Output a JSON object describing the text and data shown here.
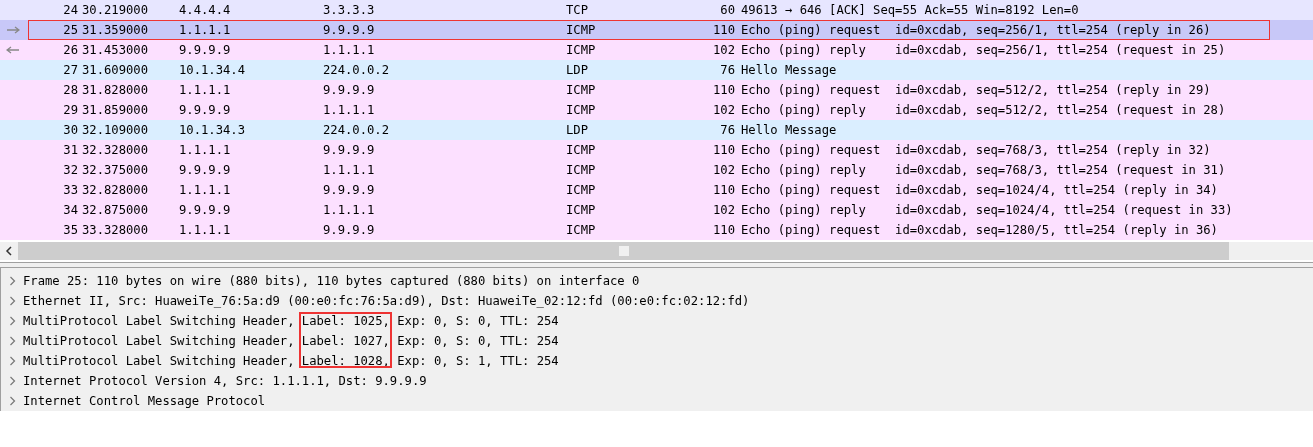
{
  "packets": [
    {
      "no": "24",
      "time": "30.219000",
      "source": "4.4.4.4",
      "destination": "3.3.3.3",
      "protocol": "TCP",
      "length": "60",
      "info": "49613 → 646 [ACK] Seq=55 Ack=55 Win=8192 Len=0",
      "selected": false,
      "kind": "plain",
      "annotated": false
    },
    {
      "no": "25",
      "time": "31.359000",
      "source": "1.1.1.1",
      "destination": "9.9.9.9",
      "protocol": "ICMP",
      "length": "110",
      "info": "Echo (ping) request  id=0xcdab, seq=256/1, ttl=254 (reply in 26)",
      "selected": true,
      "kind": "request",
      "annotated": true
    },
    {
      "no": "26",
      "time": "31.453000",
      "source": "9.9.9.9",
      "destination": "1.1.1.1",
      "protocol": "ICMP",
      "length": "102",
      "info": "Echo (ping) reply    id=0xcdab, seq=256/1, ttl=254 (request in 25)",
      "selected": false,
      "kind": "reply",
      "annotated": false
    },
    {
      "no": "27",
      "time": "31.609000",
      "source": "10.1.34.4",
      "destination": "224.0.0.2",
      "protocol": "LDP",
      "length": "76",
      "info": "Hello Message",
      "selected": false,
      "kind": "plain",
      "annotated": false
    },
    {
      "no": "28",
      "time": "31.828000",
      "source": "1.1.1.1",
      "destination": "9.9.9.9",
      "protocol": "ICMP",
      "length": "110",
      "info": "Echo (ping) request  id=0xcdab, seq=512/2, ttl=254 (reply in 29)",
      "selected": false,
      "kind": "plain",
      "annotated": false
    },
    {
      "no": "29",
      "time": "31.859000",
      "source": "9.9.9.9",
      "destination": "1.1.1.1",
      "protocol": "ICMP",
      "length": "102",
      "info": "Echo (ping) reply    id=0xcdab, seq=512/2, ttl=254 (request in 28)",
      "selected": false,
      "kind": "plain",
      "annotated": false
    },
    {
      "no": "30",
      "time": "32.109000",
      "source": "10.1.34.3",
      "destination": "224.0.0.2",
      "protocol": "LDP",
      "length": "76",
      "info": "Hello Message",
      "selected": false,
      "kind": "plain",
      "annotated": false
    },
    {
      "no": "31",
      "time": "32.328000",
      "source": "1.1.1.1",
      "destination": "9.9.9.9",
      "protocol": "ICMP",
      "length": "110",
      "info": "Echo (ping) request  id=0xcdab, seq=768/3, ttl=254 (reply in 32)",
      "selected": false,
      "kind": "plain",
      "annotated": false
    },
    {
      "no": "32",
      "time": "32.375000",
      "source": "9.9.9.9",
      "destination": "1.1.1.1",
      "protocol": "ICMP",
      "length": "102",
      "info": "Echo (ping) reply    id=0xcdab, seq=768/3, ttl=254 (request in 31)",
      "selected": false,
      "kind": "plain",
      "annotated": false
    },
    {
      "no": "33",
      "time": "32.828000",
      "source": "1.1.1.1",
      "destination": "9.9.9.9",
      "protocol": "ICMP",
      "length": "110",
      "info": "Echo (ping) request  id=0xcdab, seq=1024/4, ttl=254 (reply in 34)",
      "selected": false,
      "kind": "plain",
      "annotated": false
    },
    {
      "no": "34",
      "time": "32.875000",
      "source": "9.9.9.9",
      "destination": "1.1.1.1",
      "protocol": "ICMP",
      "length": "102",
      "info": "Echo (ping) reply    id=0xcdab, seq=1024/4, ttl=254 (request in 33)",
      "selected": false,
      "kind": "plain",
      "annotated": false
    },
    {
      "no": "35",
      "time": "33.328000",
      "source": "1.1.1.1",
      "destination": "9.9.9.9",
      "protocol": "ICMP",
      "length": "110",
      "info": "Echo (ping) request  id=0xcdab, seq=1280/5, ttl=254 (reply in 36)",
      "selected": false,
      "kind": "plain",
      "annotated": false
    }
  ],
  "details": [
    {
      "expanded": false,
      "segments": [
        {
          "text": "Frame 25: 110 bytes on wire (880 bits), 110 bytes captured (880 bits) on interface 0"
        }
      ]
    },
    {
      "expanded": false,
      "segments": [
        {
          "text": "Ethernet II, Src: HuaweiTe_76:5a:d9 (00:e0:fc:76:5a:d9), Dst: HuaweiTe_02:12:fd (00:e0:fc:02:12:fd)"
        }
      ]
    },
    {
      "expanded": false,
      "segments": [
        {
          "text": "MultiProtocol Label Switching Header,"
        },
        {
          "text": "Label: 1025,",
          "annotated": true
        },
        {
          "text": "Exp: 0, S: 0, TTL: 254"
        }
      ]
    },
    {
      "expanded": false,
      "segments": [
        {
          "text": "MultiProtocol Label Switching Header,"
        },
        {
          "text": "Label: 1027,",
          "annotated": true
        },
        {
          "text": "Exp: 0, S: 0, TTL: 254"
        }
      ]
    },
    {
      "expanded": false,
      "segments": [
        {
          "text": "MultiProtocol Label Switching Header,"
        },
        {
          "text": "Label: 1028,",
          "annotated": true
        },
        {
          "text": "Exp: 0, S: 1, TTL: 254"
        }
      ]
    },
    {
      "expanded": false,
      "segments": [
        {
          "text": "Internet Protocol Version 4, Src: 1.1.1.1, Dst: 9.9.9.9"
        }
      ]
    },
    {
      "expanded": false,
      "segments": [
        {
          "text": "Internet Control Message Protocol"
        }
      ]
    }
  ]
}
